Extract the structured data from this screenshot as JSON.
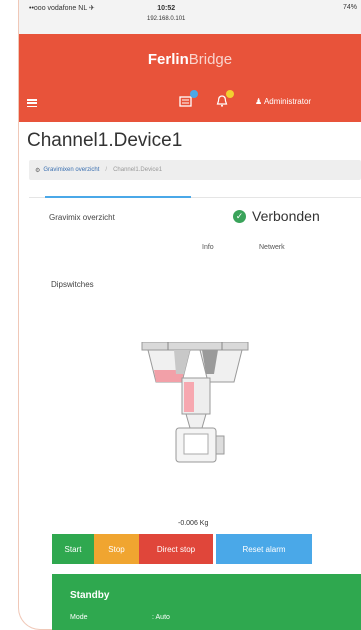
{
  "statusbar": {
    "carrier": "••ooo vodafone NL ✈",
    "time": "10:52",
    "ip": "192.168.0.101",
    "right": "74%"
  },
  "brand": {
    "bold": "Ferlin",
    "light": "Bridge"
  },
  "navbar": {
    "admin_label": "Administrator"
  },
  "page": {
    "title": "Channel1.Device1"
  },
  "breadcrumb": {
    "overview": "Gravimixen overzicht",
    "current": "Channel1.Device1"
  },
  "device": {
    "overview_label": "Gravimix overzicht",
    "connection_status": "Verbonden"
  },
  "subtabs": {
    "info": "Info",
    "netwerk": "Netwerk"
  },
  "dipswitches": {
    "label": "Dipswitches"
  },
  "weight": {
    "value": "-0.006 Kg"
  },
  "buttons": {
    "start": "Start",
    "stop": "Stop",
    "direct_stop": "Direct stop",
    "reset_alarm": "Reset alarm"
  },
  "status_panel": {
    "title": "Standby",
    "mode_label": "Mode",
    "mode_value": ": Auto"
  },
  "colors": {
    "brand": "#e8533a",
    "green": "#2fa84f",
    "orange": "#f0a530",
    "red": "#e0463a",
    "blue": "#4aa8e8"
  }
}
